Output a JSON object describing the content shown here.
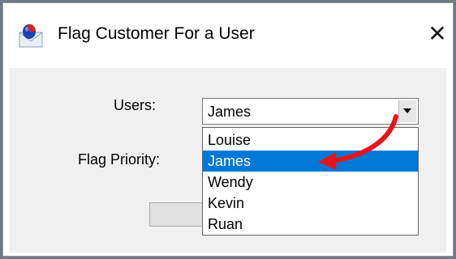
{
  "window": {
    "title": "Flag Customer For a User",
    "close_label": "✕"
  },
  "form": {
    "users_label": "Users:",
    "flag_priority_label": "Flag Priority:",
    "users_selected": "James"
  },
  "dropdown": {
    "options": [
      "Louise",
      "James",
      "Wendy",
      "Kevin",
      "Ruan"
    ],
    "highlighted": "James"
  },
  "colors": {
    "selection": "#0078d7",
    "annotation_arrow": "#e8141b"
  }
}
